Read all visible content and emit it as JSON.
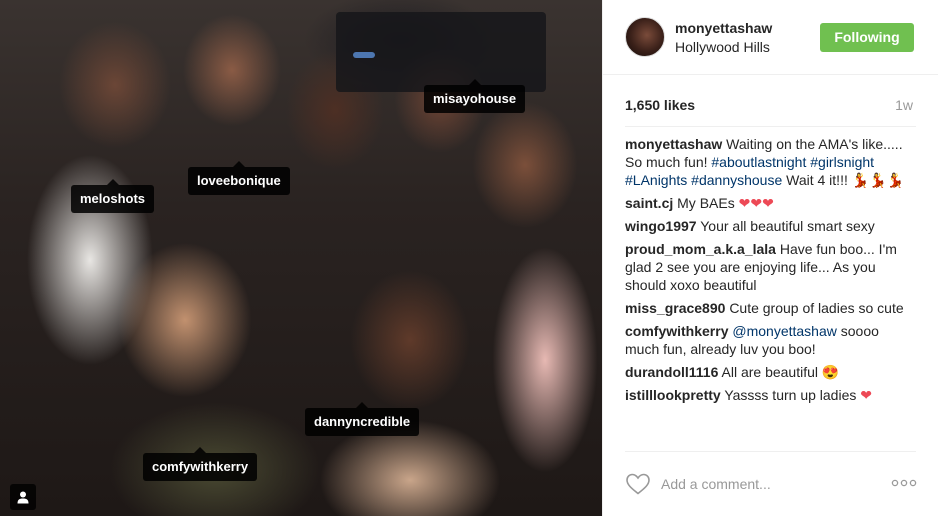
{
  "photo": {
    "tags": {
      "meloshots": "meloshots",
      "loveebonique": "loveebonique",
      "misayohouse": "misayohouse",
      "dannyncredible": "dannyncredible",
      "comfywithkerry": "comfywithkerry"
    },
    "people_icon": "person-icon"
  },
  "header": {
    "username": "monyettashaw",
    "location": "Hollywood Hills",
    "follow_label": "Following"
  },
  "stats": {
    "likes": "1,650 likes",
    "time": "1w"
  },
  "comments": [
    {
      "user": "monyettashaw",
      "text_before": "Waiting on the AMA's like..... So much fun!",
      "hashtags": [
        "#aboutlastnight",
        "#girlsnight",
        "#LAnights",
        "#dannyshouse"
      ],
      "text_after": "Wait 4 it!!! 💃💃💃"
    },
    {
      "user": "saint.cj",
      "text": "My BAEs",
      "emoji": "❤❤❤"
    },
    {
      "user": "wingo1997",
      "text": "Your all beautiful smart sexy"
    },
    {
      "user": "proud_mom_a.k.a_lala",
      "text": "Have fun boo... I'm glad 2 see you are enjoying life... As you should xoxo beautiful"
    },
    {
      "user": "miss_grace890",
      "text": "Cute group of ladies so cute"
    },
    {
      "user": "comfywithkerry",
      "mention": "@monyettashaw",
      "text": "soooo much fun, already luv you boo!"
    },
    {
      "user": "durandoll1116",
      "text": "All are beautiful",
      "emoji": "😍"
    },
    {
      "user": "istilllookpretty",
      "text": "Yassss turn up ladies",
      "emoji": "❤"
    }
  ],
  "footer": {
    "comment_placeholder": "Add a comment...",
    "like_icon": "heart-outline-icon",
    "more_icon": "ellipsis-icon"
  },
  "colors": {
    "follow_green": "#70c050",
    "hashtag_blue": "#003569",
    "heart_red": "#ed4956"
  }
}
